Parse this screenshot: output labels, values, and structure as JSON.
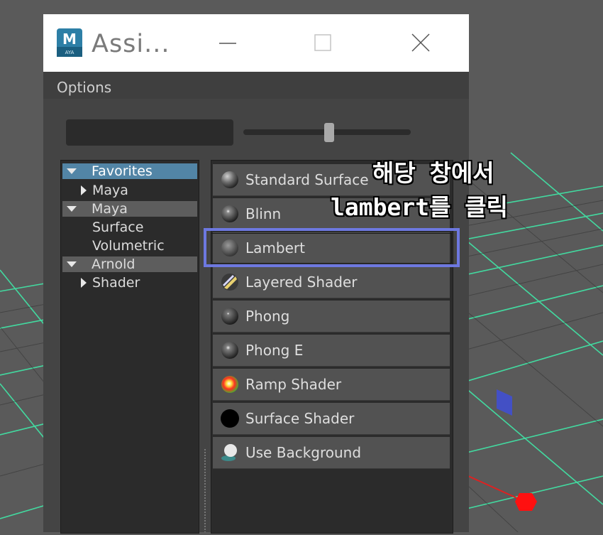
{
  "window": {
    "title": "Assi...",
    "app_icon": "maya-icon",
    "buttons": [
      "minimize-icon",
      "maximize-icon",
      "close-icon"
    ]
  },
  "menubar": {
    "items": [
      "Options"
    ]
  },
  "toolbar": {
    "search_value": "",
    "slider_level": 0.51
  },
  "tree": {
    "items": [
      {
        "label": "Favorites",
        "kind": "section",
        "state": "selected",
        "expanded": true
      },
      {
        "label": "Maya",
        "kind": "child-expandable"
      },
      {
        "label": "Maya",
        "kind": "section",
        "expanded": true
      },
      {
        "label": "Surface",
        "kind": "child"
      },
      {
        "label": "Volumetric",
        "kind": "child"
      },
      {
        "label": "Arnold",
        "kind": "section",
        "expanded": true
      },
      {
        "label": "Shader",
        "kind": "child-expandable"
      }
    ]
  },
  "shaders": [
    {
      "label": "Standard Surface",
      "icon": "standard-surface-icon"
    },
    {
      "label": "Blinn",
      "icon": "blinn-icon"
    },
    {
      "label": "Lambert",
      "icon": "lambert-icon",
      "highlighted": true
    },
    {
      "label": "Layered Shader",
      "icon": "layered-shader-icon"
    },
    {
      "label": "Phong",
      "icon": "phong-icon"
    },
    {
      "label": "Phong E",
      "icon": "phong-e-icon"
    },
    {
      "label": "Ramp Shader",
      "icon": "ramp-shader-icon"
    },
    {
      "label": "Surface Shader",
      "icon": "surface-shader-icon"
    },
    {
      "label": "Use Background",
      "icon": "use-background-icon"
    }
  ],
  "annotation": {
    "line1": "해당 창에서",
    "line2": "lambert를 클릭"
  },
  "colors": {
    "grid_line": "#40e8a8",
    "highlight_box": "#6d78e0",
    "selection": "#5285a6",
    "viewport_bg": "#5a5a5a"
  }
}
